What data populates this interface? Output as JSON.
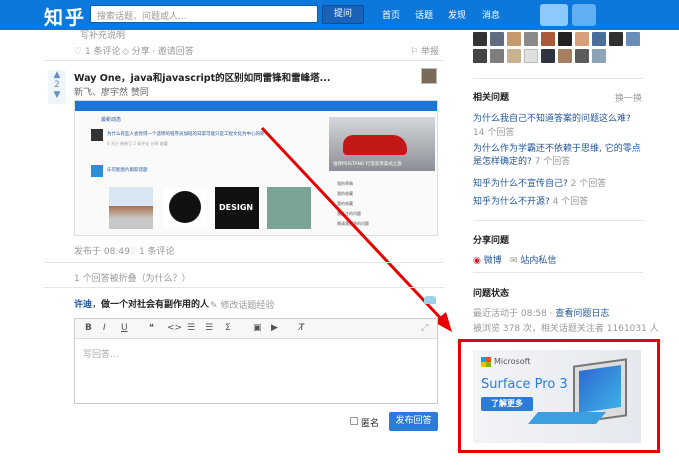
{
  "topbar": {
    "logo": "知乎",
    "search_placeholder": "搜索话题、问题或人...",
    "ask_label": "提问",
    "nav": [
      "首页",
      "话题",
      "发现",
      "消息"
    ]
  },
  "answer_prev": {
    "title_partial": "写补充说明",
    "comments": "1 条评论",
    "share": "分享",
    "invite": "邀请回答",
    "report": "举报"
  },
  "answer": {
    "votes": "2",
    "title": "Way One，java和javascript的区别如同雷锋和雷峰塔...",
    "voters": "新飞、廖宇然 赞同",
    "posted": "发布于 08:49",
    "comments": "1 条评论"
  },
  "folded": "1 个回答被折叠（为什么？）",
  "composer": {
    "user": "许迪",
    "user_desc": "做一个对社会有副作用的人",
    "edit_link": "修改话题经验",
    "placeholder": "写回答...",
    "anonymous": "匿名",
    "submit": "发布回答",
    "toolbar": [
      "B",
      "I",
      "U",
      "❝",
      "<>",
      "☰",
      "☰",
      "Σ",
      "▣",
      "▶",
      "T̸"
    ]
  },
  "embedded": {
    "header": "最新动态",
    "question1": "为什么有些人会觉得一个悲惨的程序员加班的日常可能只是工程文化为中心的呢?",
    "meta1": "4 天日 新修订      2 条评论  分享  收藏",
    "section2": "乐可能图片跟踪话题",
    "car_caption": "强悍MUSTANG  打造澎湃美式之旅",
    "card_links": [
      "我的草稿",
      "我的收藏",
      "我的收藏",
      "我关注的问题",
      "邀请我回答的问题"
    ],
    "thumb_text": "DESIGN"
  },
  "sidebar": {
    "related_title": "相关问题",
    "refresh": "换一换",
    "related": [
      {
        "q": "为什么我自己不知道答案的问题这么难?",
        "count": "14 个回答"
      },
      {
        "q": "为什么作为学霸还不依赖于思维, 它的零点是怎样确定的?",
        "count": "7 个回答"
      },
      {
        "q": "知乎为什么不宣传自己?",
        "count": "2 个回答"
      },
      {
        "q": "知乎为什么不开源?",
        "count": "4 个回答"
      }
    ],
    "share_title": "分享问题",
    "share_weibo": "微博",
    "share_msg": "站内私信",
    "status_title": "问题状态",
    "last_active": "最近活动于 08:58 ·",
    "view_log": "查看问题日志",
    "stats": "被浏览 378 次，相关话题关注者 1161031 人"
  },
  "ad": {
    "brand": "Microsoft",
    "product": "Surface Pro 3",
    "cta": "了解更多"
  },
  "colors": {
    "topbar": "#0c78dc",
    "link": "#225599",
    "highlight": "#e60000",
    "ad_button": "#2b7cd9"
  }
}
